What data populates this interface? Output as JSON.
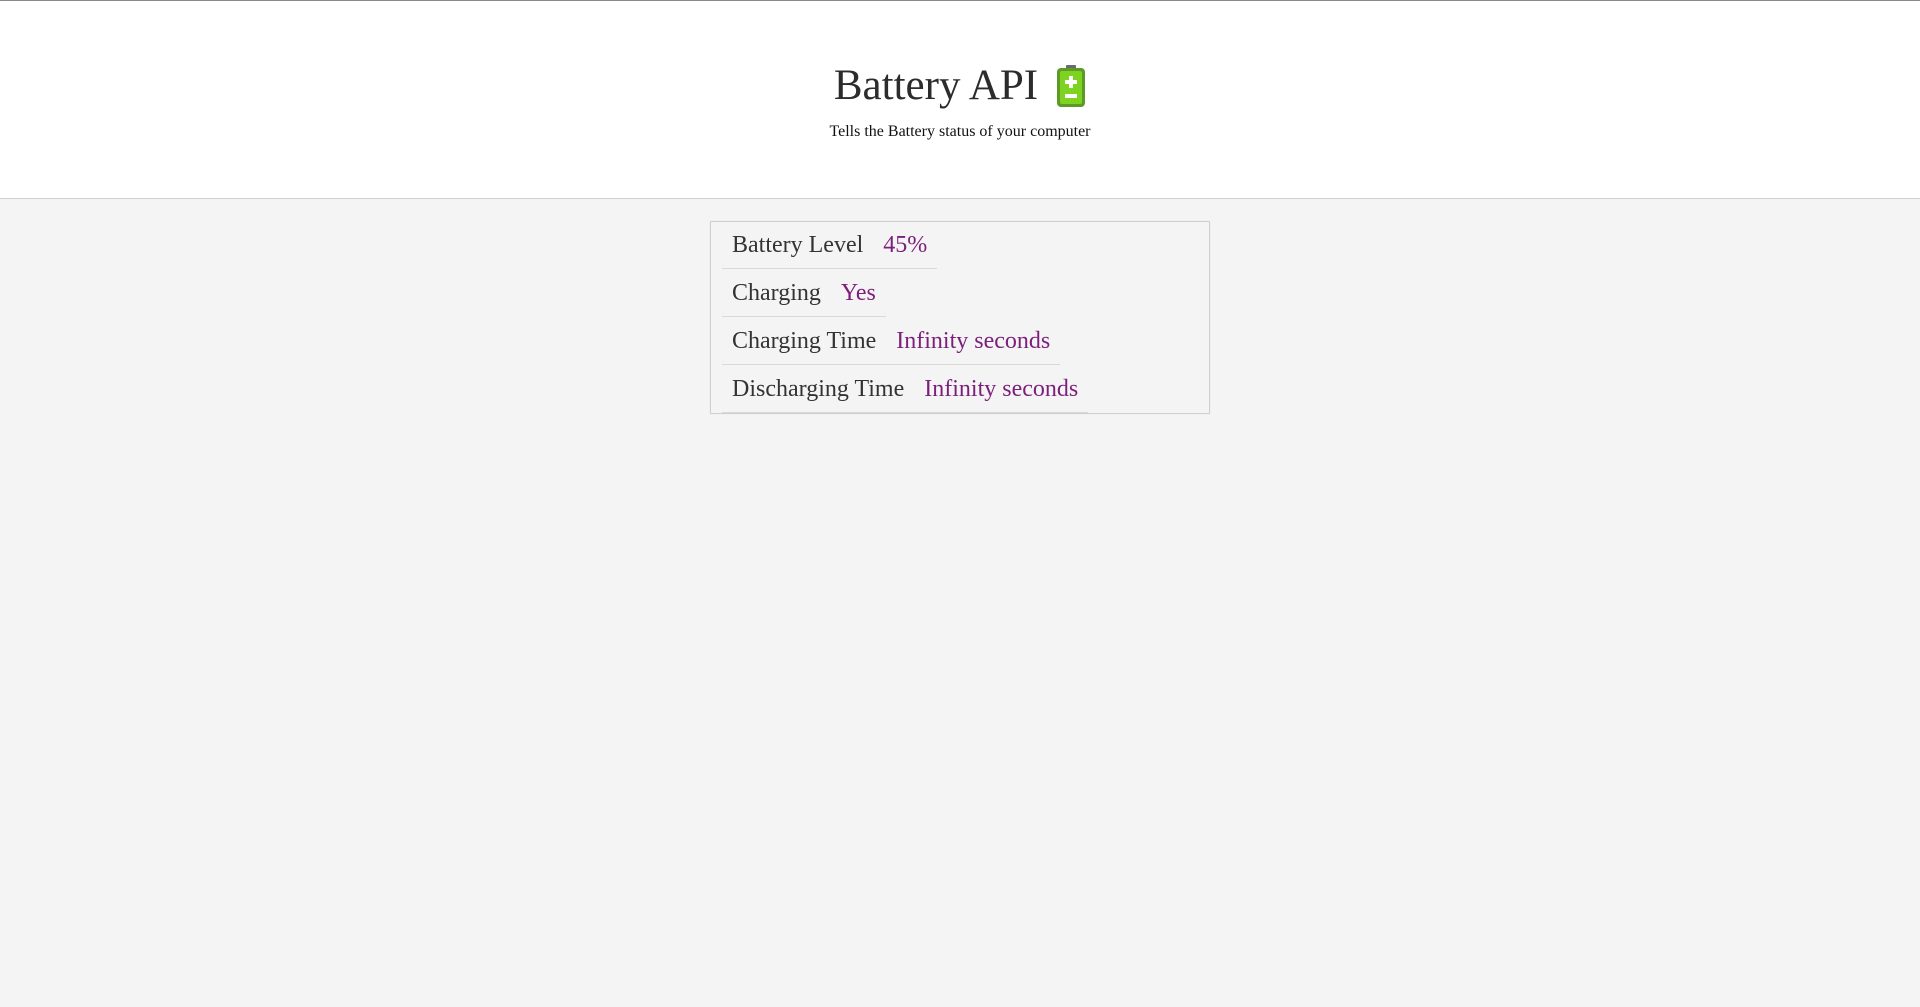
{
  "header": {
    "title": "Battery API",
    "icon": "battery-icon",
    "subtitle": "Tells the Battery status of your computer"
  },
  "status": {
    "rows": [
      {
        "label": "Battery Level",
        "value": "45%"
      },
      {
        "label": "Charging",
        "value": "Yes"
      },
      {
        "label": "Charging Time",
        "value": "Infinity seconds"
      },
      {
        "label": "Discharging Time",
        "value": "Infinity seconds"
      }
    ]
  },
  "colors": {
    "value_text": "#7b1f7b",
    "label_text": "#333333",
    "battery_fill": "#7ed321",
    "battery_body": "#5d9b28"
  },
  "battery_level": 0.45
}
